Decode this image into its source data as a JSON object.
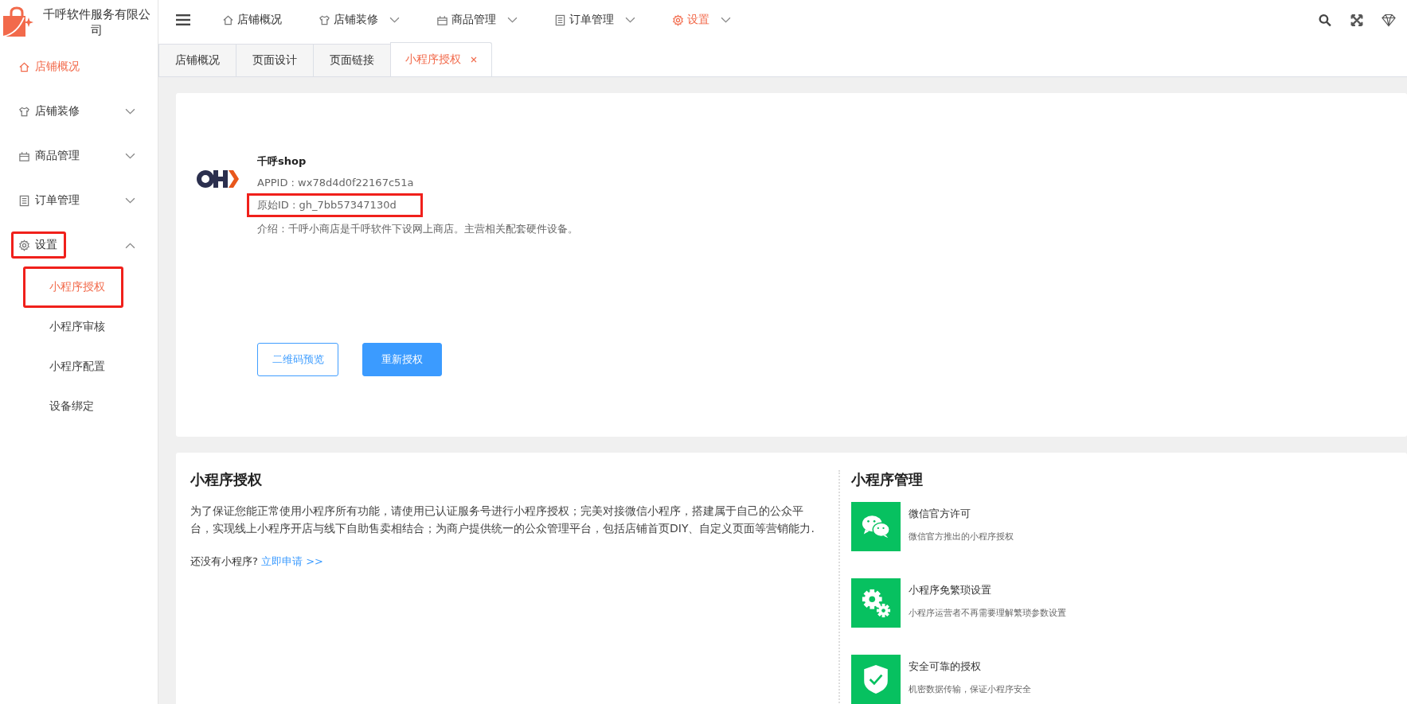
{
  "brand": {
    "name": "千呼软件服务有限公司"
  },
  "top_nav": [
    {
      "label": "店铺概况",
      "dropdown": false,
      "selected": false
    },
    {
      "label": "店铺装修",
      "dropdown": true,
      "selected": false
    },
    {
      "label": "商品管理",
      "dropdown": true,
      "selected": false
    },
    {
      "label": "订单管理",
      "dropdown": true,
      "selected": false
    },
    {
      "label": "设置",
      "dropdown": true,
      "selected": true
    }
  ],
  "tabs": [
    {
      "label": "店铺概况",
      "selected": false,
      "closable": false
    },
    {
      "label": "页面设计",
      "selected": false,
      "closable": false
    },
    {
      "label": "页面链接",
      "selected": false,
      "closable": false
    },
    {
      "label": "小程序授权",
      "selected": true,
      "closable": true
    }
  ],
  "sidebar": {
    "items": [
      {
        "label": "店铺概况",
        "kind": "link",
        "selected": true,
        "highlighted": false
      },
      {
        "label": "店铺装修",
        "kind": "group",
        "expanded": false,
        "highlighted": false
      },
      {
        "label": "商品管理",
        "kind": "group",
        "expanded": false,
        "highlighted": false
      },
      {
        "label": "订单管理",
        "kind": "group",
        "expanded": false,
        "highlighted": false
      },
      {
        "label": "设置",
        "kind": "group",
        "expanded": true,
        "highlighted": true,
        "children": [
          {
            "label": "小程序授权",
            "selected": true,
            "highlighted": true
          },
          {
            "label": "小程序审核",
            "selected": false,
            "highlighted": false
          },
          {
            "label": "小程序配置",
            "selected": false,
            "highlighted": false
          },
          {
            "label": "设备绑定",
            "selected": false,
            "highlighted": false
          }
        ]
      }
    ]
  },
  "app_card": {
    "name": "千呼shop",
    "fields": [
      {
        "text": "APPID : wx78d4d0f22167c51a",
        "highlighted": false
      },
      {
        "text": "原始ID : gh_7bb57347130d",
        "highlighted": true
      },
      {
        "text": "介绍 : 千呼小商店是千呼软件下设网上商店。主营相关配套硬件设备。",
        "highlighted": false
      }
    ],
    "buttons": [
      {
        "label": "二维码预览",
        "kind": "outline"
      },
      {
        "label": "重新授权",
        "kind": "primary"
      }
    ]
  },
  "auth_section": {
    "title": "小程序授权",
    "description": "为了保证您能正常使用小程序所有功能，请使用已认证服务号进行小程序授权；完美对接微信小程序，搭建属于自己的公众平台，实现线上小程序开店与线下自助售卖相结合；为商户提供统一的公众管理平台，包括店铺首页DIY、自定义页面等营销能力.",
    "prompt": "还没有小程序?",
    "link": "立即申请 >>"
  },
  "management": {
    "title": "小程序管理",
    "features": [
      {
        "title": "微信官方许可",
        "description": "微信官方推出的小程序授权"
      },
      {
        "title": "小程序免繁琐设置",
        "description": "小程序运营者不再需要理解繁琐参数设置"
      },
      {
        "title": "安全可靠的授权",
        "description": "机密数据传输，保证小程序安全"
      }
    ]
  }
}
